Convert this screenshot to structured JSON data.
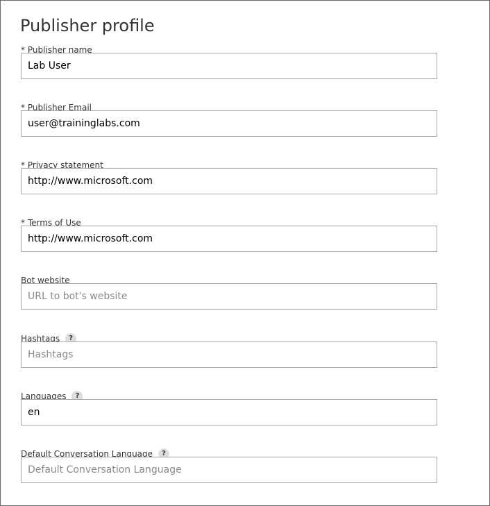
{
  "title": "Publisher profile",
  "fields": [
    {
      "label": "* Publisher name",
      "value": "Lab User",
      "placeholder": "",
      "help": false
    },
    {
      "label": "* Publisher Email",
      "value": "user@traininglabs.com",
      "placeholder": "",
      "help": false
    },
    {
      "label": "* Privacy statement",
      "value": "http://www.microsoft.com",
      "placeholder": "",
      "help": false
    },
    {
      "label": "* Terms of Use",
      "value": "http://www.microsoft.com",
      "placeholder": "",
      "help": false
    },
    {
      "label": "Bot website",
      "value": "",
      "placeholder": "URL to bot's website",
      "help": false
    },
    {
      "label": "Hashtags",
      "value": "",
      "placeholder": "Hashtags",
      "help": true
    },
    {
      "label": "Languages",
      "value": "en",
      "placeholder": "",
      "help": true
    },
    {
      "label": "Default Conversation Language",
      "value": "",
      "placeholder": "Default Conversation Language",
      "help": true
    }
  ],
  "help_icon_glyph": "?",
  "colors": {
    "input_border": "#a6a6a6",
    "help_badge": "#dedede",
    "frame_border": "#6b6b6b"
  }
}
